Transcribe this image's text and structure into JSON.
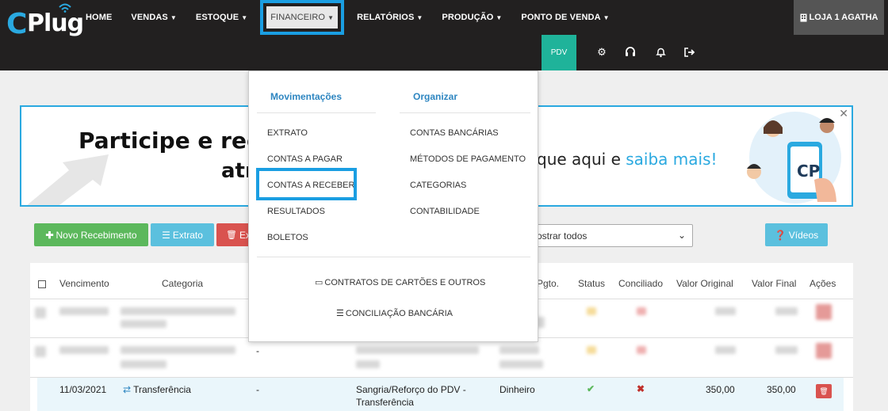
{
  "logo": {
    "c": "C",
    "rest": "Plug"
  },
  "nav": {
    "home": "HOME",
    "vendas": "VENDAS",
    "estoque": "ESTOQUE",
    "financeiro": "FINANCEIRO",
    "relatorios": "RELATÓRIOS",
    "producao": "PRODUÇÃO",
    "ponto": "PONTO DE VENDA"
  },
  "store": "LOJA 1 AGATHA",
  "pdv": "PDV",
  "banner": {
    "line1": "Participe e rece",
    "line2": "atr",
    "line3_pre": "que aqui e ",
    "line3_link": "saiba mais",
    "line3_post": "!"
  },
  "buttons": {
    "novo": "Novo Recebimento",
    "extrato": "Extrato",
    "ex": "Ex",
    "videos": "Vídeos"
  },
  "filter": {
    "value": "ostrar todos"
  },
  "table": {
    "headers": {
      "vencimento": "Vencimento",
      "categoria": "Categoria",
      "pgto": "Pgto.",
      "status": "Status",
      "conciliado": "Conciliado",
      "valor_original": "Valor Original",
      "valor_final": "Valor Final",
      "acoes": "Ações"
    },
    "row": {
      "vencimento": "11/03/2021",
      "categoria": "Transferência",
      "col3": "-",
      "descricao_1": "Sangria/Reforço do PDV -",
      "descricao_2": "Transferência",
      "pgto": "Dinheiro",
      "valor_original": "350,00",
      "valor_final": "350,00"
    },
    "row2_dash": "-"
  },
  "dropdown": {
    "col1_title": "Movimentações",
    "col2_title": "Organizar",
    "col1": [
      "EXTRATO",
      "CONTAS A PAGAR",
      "CONTAS A RECEBER",
      "RESULTADOS",
      "BOLETOS"
    ],
    "col2": [
      "CONTAS BANCÁRIAS",
      "MÉTODOS DE PAGAMENTO",
      "CATEGORIAS",
      "CONTABILIDADE"
    ],
    "bottom1": "CONTRATOS DE CARTÕES E OUTROS",
    "bottom2": "CONCILIAÇÃO BANCÁRIA"
  },
  "colors": {
    "accent": "#1a9ee2",
    "pdv": "#1fb39a",
    "green": "#5cb85c",
    "info": "#5bc0de",
    "danger": "#d9534f"
  }
}
